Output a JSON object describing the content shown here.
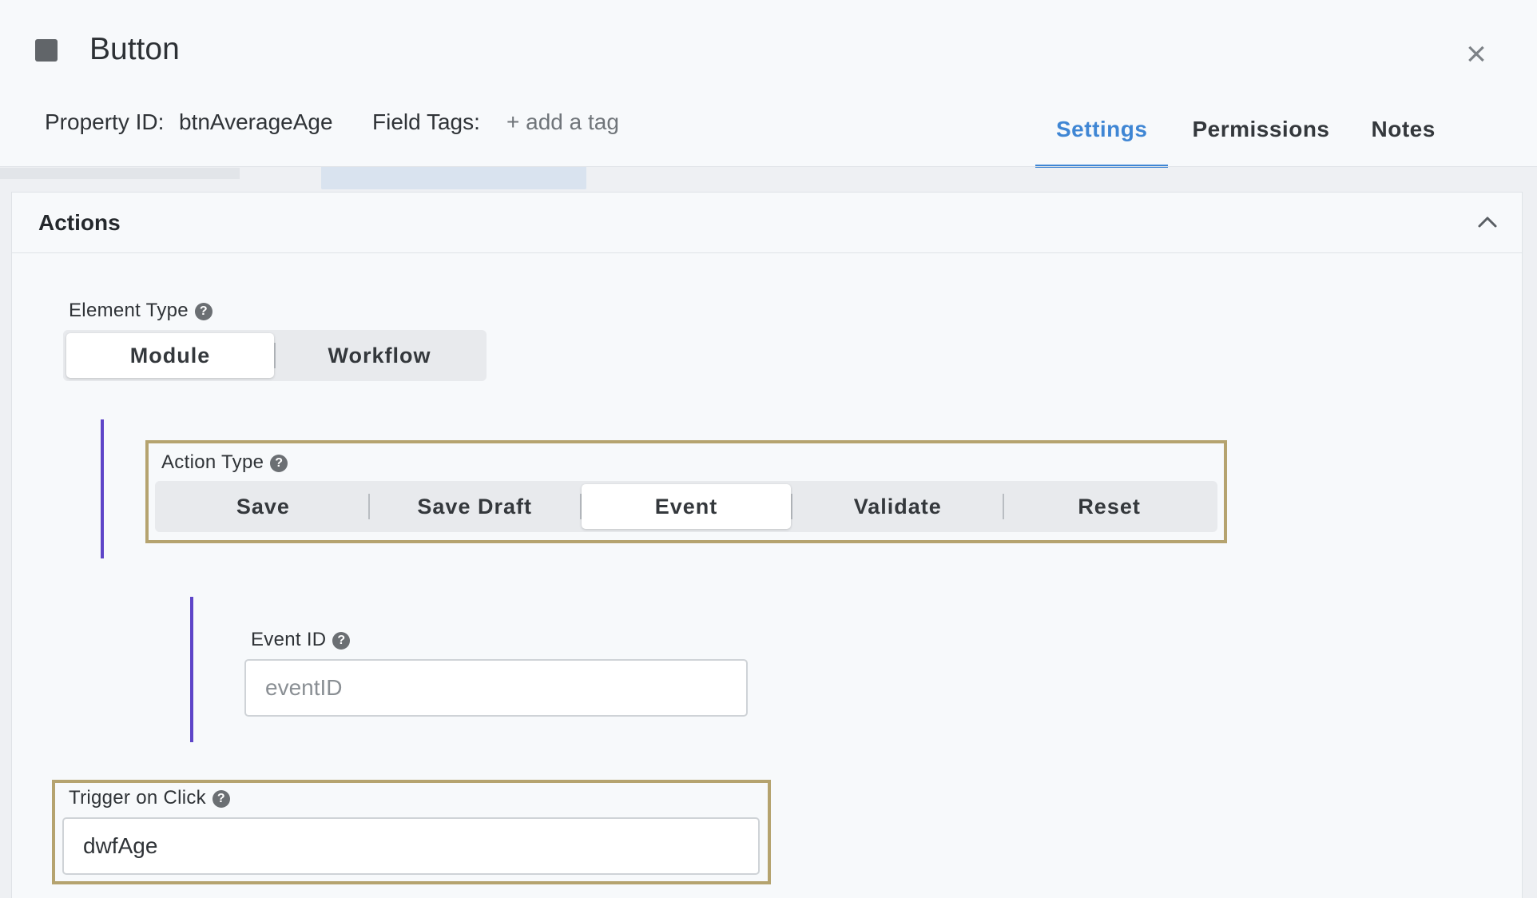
{
  "header": {
    "title": "Button",
    "property_id_label": "Property ID:",
    "property_id_value": "btnAverageAge",
    "field_tags_label": "Field Tags:",
    "add_tag": "+ add a tag",
    "close_glyph": "×",
    "tabs": [
      {
        "label": "Settings",
        "active": true
      },
      {
        "label": "Permissions",
        "active": false
      },
      {
        "label": "Notes",
        "active": false
      }
    ]
  },
  "panel": {
    "title": "Actions",
    "element_type": {
      "label": "Element Type",
      "options": [
        "Module",
        "Workflow"
      ],
      "selected": "Module"
    },
    "action_type": {
      "label": "Action Type",
      "options": [
        "Save",
        "Save Draft",
        "Event",
        "Validate",
        "Reset"
      ],
      "selected": "Event"
    },
    "event_id": {
      "label": "Event ID",
      "value": "",
      "placeholder": "eventID"
    },
    "trigger_on_click": {
      "label": "Trigger on Click",
      "value": "dwfAge"
    }
  },
  "colors": {
    "accent": "#3f86d4",
    "highlight_border": "#b5a36f",
    "nest_bar": "#5e45c8"
  },
  "help_glyph": "?"
}
